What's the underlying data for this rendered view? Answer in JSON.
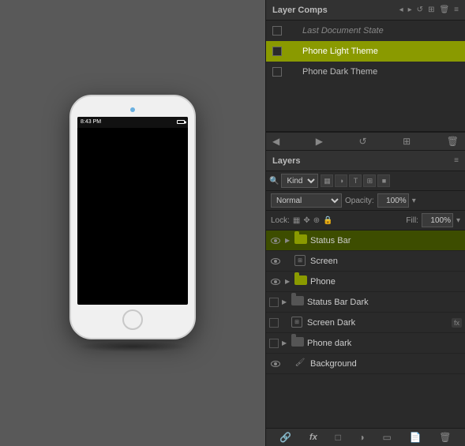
{
  "canvas": {
    "phone": {
      "time": "8:43 PM"
    }
  },
  "layerComps": {
    "title": "Layer Comps",
    "menu_icon": "≡",
    "collapse_icon": "◂",
    "expand_icon": "▸",
    "items": [
      {
        "id": "last-doc",
        "name": "Last Document State",
        "italic": true,
        "active": false,
        "hasIcon": false
      },
      {
        "id": "phone-light",
        "name": "Phone Light Theme",
        "italic": false,
        "active": true,
        "hasIcon": true
      },
      {
        "id": "phone-dark",
        "name": "Phone Dark Theme",
        "italic": false,
        "active": false,
        "hasIcon": false
      }
    ]
  },
  "layers": {
    "title": "Layers",
    "menu_icon": "≡",
    "kind_label": "Kind",
    "mode_label": "Normal",
    "opacity_label": "Opacity:",
    "opacity_value": "100%",
    "lock_label": "Lock:",
    "fill_label": "Fill:",
    "fill_value": "100%",
    "items": [
      {
        "id": "status-bar",
        "name": "Status Bar",
        "visible": true,
        "type": "folder",
        "active": true,
        "indent": 0,
        "hasFx": false
      },
      {
        "id": "screen",
        "name": "Screen",
        "visible": true,
        "type": "smart",
        "active": false,
        "indent": 0,
        "hasFx": false
      },
      {
        "id": "phone",
        "name": "Phone",
        "visible": true,
        "type": "folder",
        "active": false,
        "indent": 0,
        "hasFx": false
      },
      {
        "id": "status-bar-dark",
        "name": "Status Bar Dark",
        "visible": false,
        "type": "folder-dark",
        "active": false,
        "indent": 0,
        "hasFx": false
      },
      {
        "id": "screen-dark",
        "name": "Screen Dark",
        "visible": false,
        "type": "smart",
        "active": false,
        "indent": 0,
        "hasFx": true
      },
      {
        "id": "phone-dark",
        "name": "Phone dark",
        "visible": false,
        "type": "folder-dark",
        "active": false,
        "indent": 0,
        "hasFx": false
      },
      {
        "id": "background",
        "name": "Background",
        "visible": true,
        "type": "brush",
        "active": false,
        "indent": 0,
        "hasFx": false
      }
    ],
    "bottom_toolbar": {
      "link_icon": "🔗",
      "fx_icon": "fx",
      "new_group_icon": "□",
      "adjustment_icon": "◑",
      "add_mask_icon": "▭",
      "new_layer_icon": "📄",
      "delete_icon": "🗑"
    }
  }
}
